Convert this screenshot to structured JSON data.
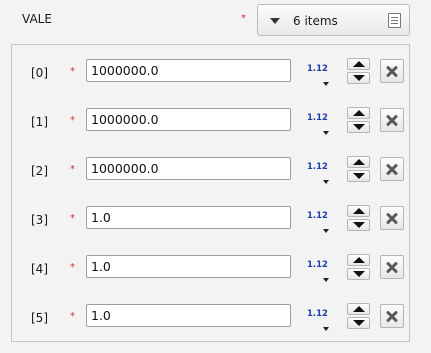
{
  "field": {
    "label": "VALE",
    "required_mark": "*"
  },
  "items_button": {
    "count_label": "6 items",
    "caret_icon": "triangle-down-icon",
    "menu_icon": "list-menu-icon"
  },
  "rows": [
    {
      "index": "[0]",
      "required_mark": "*",
      "value": "1000000.0",
      "format_label": "1.12"
    },
    {
      "index": "[1]",
      "required_mark": "*",
      "value": "1000000.0",
      "format_label": "1.12"
    },
    {
      "index": "[2]",
      "required_mark": "*",
      "value": "1000000.0",
      "format_label": "1.12"
    },
    {
      "index": "[3]",
      "required_mark": "*",
      "value": "1.0",
      "format_label": "1.12"
    },
    {
      "index": "[4]",
      "required_mark": "*",
      "value": "1.0",
      "format_label": "1.12"
    },
    {
      "index": "[5]",
      "required_mark": "*",
      "value": "1.0",
      "format_label": "1.12"
    }
  ],
  "colors": {
    "required": "#d32f2f",
    "format_label": "#1e3fa8",
    "background": "#f3f3f3"
  }
}
